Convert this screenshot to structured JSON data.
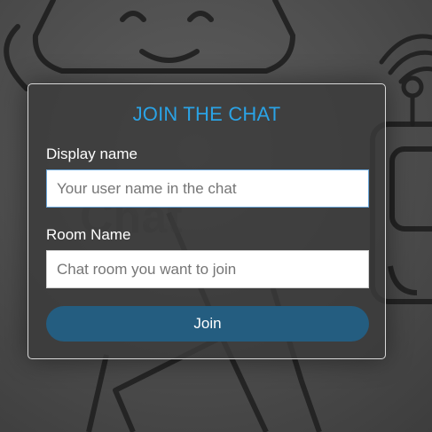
{
  "form": {
    "title": "JOIN THE CHAT",
    "display_name_label": "Display name",
    "display_name_value": "",
    "display_name_placeholder": "Your user name in the chat",
    "room_name_label": "Room Name",
    "room_name_value": "",
    "room_name_placeholder": "Chat room you want to join",
    "join_label": "Join"
  },
  "colors": {
    "title": "#2aa3e6",
    "join_button": "#245d80",
    "background": "#505050"
  },
  "background_art": {
    "icons": [
      "robot-face-icon",
      "robot-body-icon",
      "wifi-signal-icon"
    ]
  }
}
